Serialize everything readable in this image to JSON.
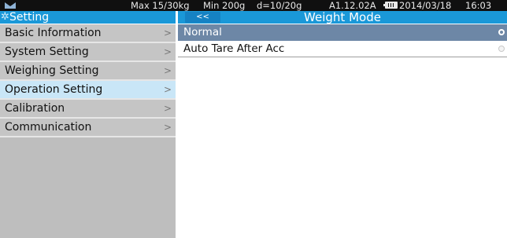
{
  "status_bar": {
    "capacity": "Max 15/30kg",
    "minimum": "Min 200g",
    "division": "d=10/20g",
    "version": "A1.12.02A",
    "date": "2014/03/18",
    "time": "16:03"
  },
  "sidebar": {
    "title": "Setting",
    "items": [
      {
        "label": "Basic Information",
        "selected": false
      },
      {
        "label": "System Setting",
        "selected": false
      },
      {
        "label": "Weighing Setting",
        "selected": false
      },
      {
        "label": "Operation Setting",
        "selected": true
      },
      {
        "label": "Calibration",
        "selected": false
      },
      {
        "label": "Communication",
        "selected": false
      }
    ],
    "chevron": ">"
  },
  "panel": {
    "back_label": "<<",
    "title": "Weight Mode",
    "options": [
      {
        "label": "Normal",
        "selected": true
      },
      {
        "label": "Auto Tare After Acc",
        "selected": false
      }
    ]
  },
  "colors": {
    "header_blue": "#1a98d8",
    "selected_row": "#6d87a6",
    "sidebar_gray": "#c5c5c5",
    "sidebar_selected": "#c9e6f7"
  }
}
